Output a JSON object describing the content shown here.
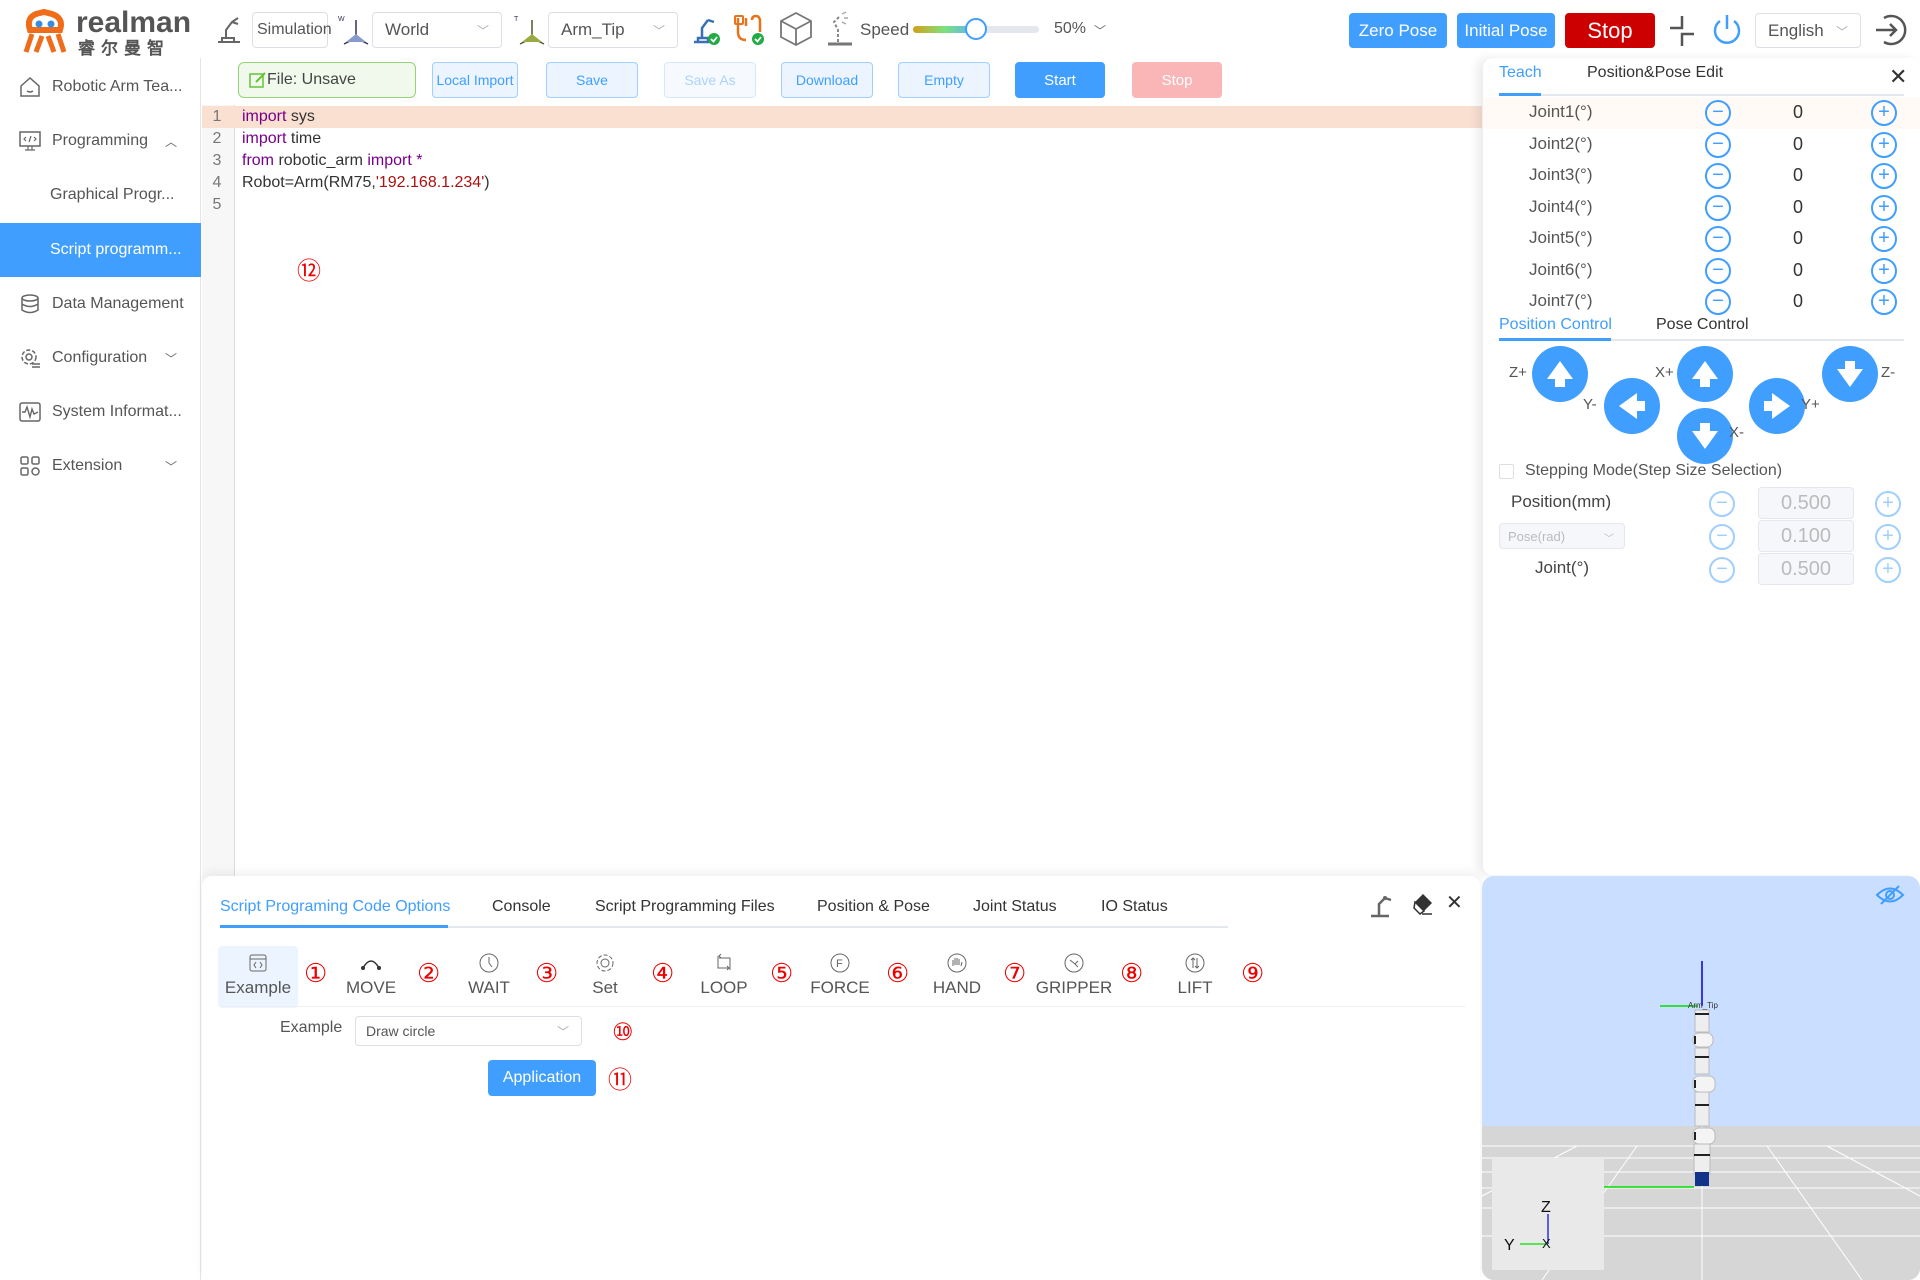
{
  "header": {
    "brand": "realman",
    "brand_cn": "睿尔曼智能",
    "mode_value": "Simulation",
    "coord_select": "World",
    "tool_select": "Arm_Tip",
    "speed_label": "Speed",
    "speed_percent": "50%",
    "speed_fraction": 0.5,
    "zero_pose": "Zero Pose",
    "initial_pose": "Initial Pose",
    "stop": "Stop",
    "language": "English"
  },
  "sidebar": {
    "items": [
      {
        "label": "Robotic Arm Tea...",
        "icon": "home-icon"
      },
      {
        "label": "Programming",
        "icon": "code-monitor-icon",
        "expanded": true
      },
      {
        "label": "Graphical Progr...",
        "sub": true
      },
      {
        "label": "Script programm...",
        "sub": true,
        "active": true
      },
      {
        "label": "Data Management",
        "icon": "database-icon"
      },
      {
        "label": "Configuration",
        "icon": "config-icon"
      },
      {
        "label": "System Informat...",
        "icon": "pulse-icon"
      },
      {
        "label": "Extension",
        "icon": "grid-icon"
      }
    ]
  },
  "toolbar": {
    "file_status": "File:  Unsave",
    "local_import": "Local Import",
    "save": "Save",
    "save_as": "Save As",
    "download": "Download",
    "empty": "Empty",
    "start": "Start",
    "stop": "Stop"
  },
  "editor": {
    "lines": [
      {
        "num": "1",
        "parts": [
          {
            "t": "import",
            "c": "kw"
          },
          {
            "t": " sys",
            "c": ""
          }
        ]
      },
      {
        "num": "2",
        "parts": [
          {
            "t": "import",
            "c": "kw"
          },
          {
            "t": " time",
            "c": ""
          }
        ]
      },
      {
        "num": "3",
        "parts": [
          {
            "t": "from",
            "c": "kw"
          },
          {
            "t": " robotic_arm ",
            "c": ""
          },
          {
            "t": "import *",
            "c": "kw"
          }
        ]
      },
      {
        "num": "4",
        "parts": [
          {
            "t": "Robot=Arm(RM75,",
            "c": ""
          },
          {
            "t": "'192.168.1.234'",
            "c": "str"
          },
          {
            "t": ")",
            "c": ""
          }
        ]
      },
      {
        "num": "5",
        "parts": []
      }
    ],
    "annotation": "⑫"
  },
  "teach": {
    "tabs": [
      "Teach",
      "Position&Pose Edit"
    ],
    "joints": [
      {
        "label": "Joint1(°)",
        "value": "0"
      },
      {
        "label": "Joint2(°)",
        "value": "0"
      },
      {
        "label": "Joint3(°)",
        "value": "0"
      },
      {
        "label": "Joint4(°)",
        "value": "0"
      },
      {
        "label": "Joint5(°)",
        "value": "0"
      },
      {
        "label": "Joint6(°)",
        "value": "0"
      },
      {
        "label": "Joint7(°)",
        "value": "0"
      }
    ],
    "control_tabs": [
      "Position Control",
      "Pose Control"
    ],
    "axis_labels": {
      "zp": "Z+",
      "ym": "Y-",
      "xp": "X+",
      "xm": "X-",
      "yp": "Y+",
      "zm": "Z-"
    },
    "stepping_label": "Stepping Mode(Step Size Selection)",
    "stepping_checked": false,
    "steps": [
      {
        "label": "Position(mm)",
        "value": "0.500"
      },
      {
        "label": "Pose(rad)",
        "value": "0.100",
        "select": true
      },
      {
        "label": "Joint(°)",
        "value": "0.500"
      }
    ]
  },
  "bottom": {
    "tabs": [
      "Script Programing Code Options",
      "Console",
      "Script Programming Files",
      "Position & Pose",
      "Joint Status",
      "IO Status"
    ],
    "options": [
      {
        "label": "Example",
        "num": "①"
      },
      {
        "label": "MOVE",
        "num": "②"
      },
      {
        "label": "WAIT",
        "num": "③"
      },
      {
        "label": "Set",
        "num": "④"
      },
      {
        "label": "LOOP",
        "num": "⑤"
      },
      {
        "label": "FORCE",
        "num": "⑥"
      },
      {
        "label": "HAND",
        "num": "⑦"
      },
      {
        "label": "GRIPPER",
        "num": "⑧"
      },
      {
        "label": "LIFT",
        "num": "⑨"
      }
    ],
    "example_label": "Example",
    "example_value": "Draw circle",
    "example_num": "⑩",
    "apply": "Application",
    "apply_num": "⑪"
  },
  "view3d": {
    "tip_label": "Arm_Tip",
    "axis_z": "Z",
    "axis_y": "Y",
    "axis_x": "X"
  },
  "colors": {
    "accent": "#409eff",
    "danger": "#cc0000",
    "annotation": "#ee0000"
  }
}
